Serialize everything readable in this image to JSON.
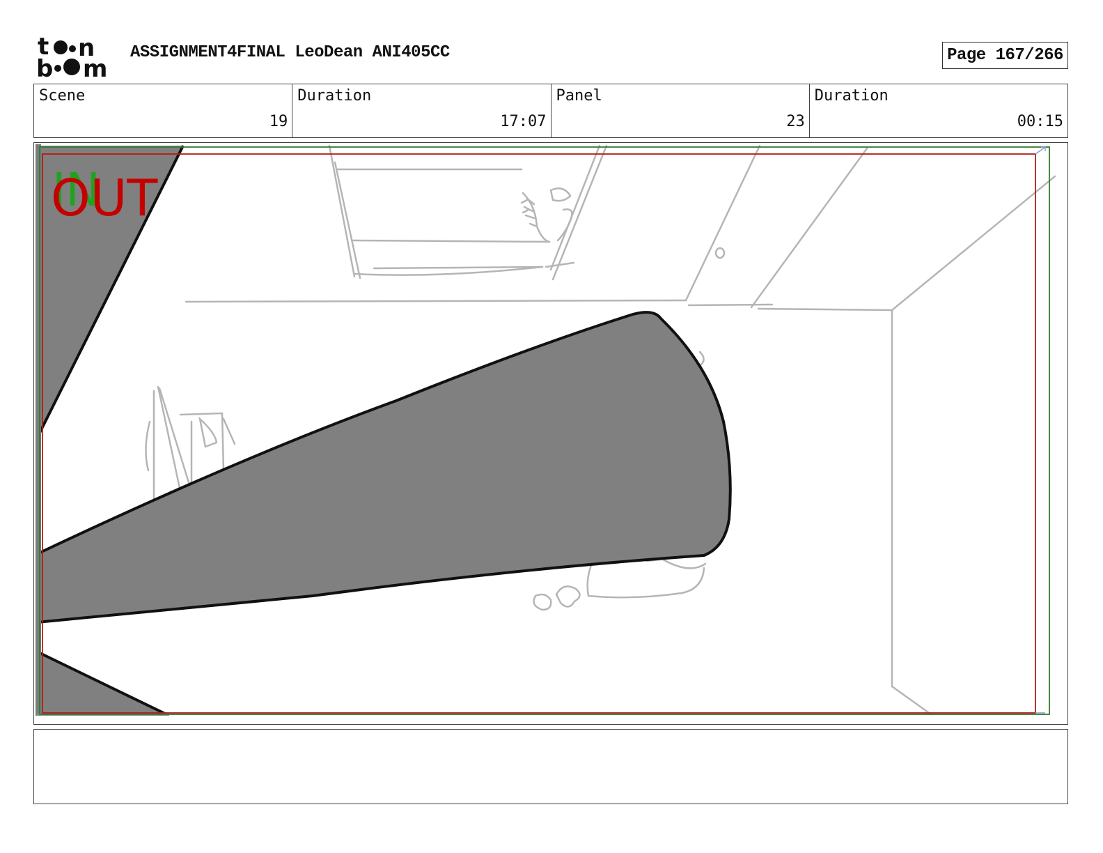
{
  "header": {
    "logo_text": "toon boom",
    "title": "ASSIGNMENT4FINAL LeoDean ANI405CC",
    "page_label": "Page",
    "page_number": "167/266"
  },
  "info": {
    "scene_label": "Scene",
    "scene_value": "19",
    "scene_duration_label": "Duration",
    "scene_duration_value": "17:07",
    "panel_label": "Panel",
    "panel_value": "23",
    "panel_duration_label": "Duration",
    "panel_duration_value": "00:15"
  },
  "panel_image": {
    "in_marker": "IN",
    "out_marker": "OUT",
    "colors": {
      "in_marker": "#1fa31f",
      "out_marker": "#c40000",
      "safe_frame": "#b31b1b",
      "camera_frame": "#2e7d2e",
      "shadow_fill": "#808080",
      "sketch_line": "#b5b5b5"
    }
  },
  "notes": {
    "text": ""
  }
}
